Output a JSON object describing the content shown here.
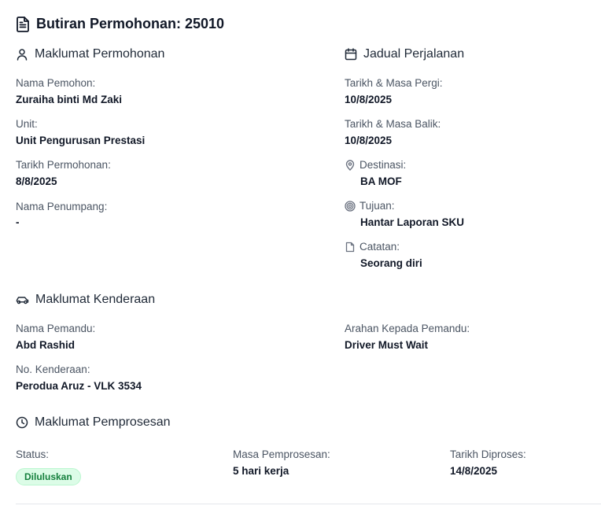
{
  "header": {
    "title": "Butiran Permohonan: 25010",
    "icon": "document-icon"
  },
  "applicant": {
    "heading": "Maklumat Permohonan",
    "icon": "user-icon",
    "fields": [
      {
        "label": "Nama Pemohon:",
        "value": "Zuraiha binti Md Zaki"
      },
      {
        "label": "Unit:",
        "value": "Unit Pengurusan Prestasi"
      },
      {
        "label": "Tarikh Permohonan:",
        "value": "8/8/2025"
      },
      {
        "label": "Nama Penumpang:",
        "value": "-"
      }
    ]
  },
  "schedule": {
    "heading": "Jadual Perjalanan",
    "icon": "calendar-icon",
    "fields": [
      {
        "label": "Tarikh & Masa Pergi:",
        "value": "10/8/2025"
      },
      {
        "label": "Tarikh & Masa Balik:",
        "value": "10/8/2025"
      },
      {
        "label": "Destinasi:",
        "value": "BA MOF",
        "icon": "map-pin-icon"
      },
      {
        "label": "Tujuan:",
        "value": "Hantar Laporan SKU",
        "icon": "target-icon"
      },
      {
        "label": "Catatan:",
        "value": "Seorang diri",
        "icon": "file-icon"
      }
    ]
  },
  "vehicle": {
    "heading": "Maklumat Kenderaan",
    "icon": "car-icon",
    "fields": [
      {
        "label": "Nama Pemandu:",
        "value": "Abd Rashid"
      },
      {
        "label": "Arahan Kepada Pemandu:",
        "value": "Driver Must Wait"
      },
      {
        "label": "No. Kenderaan:",
        "value": "Perodua Aruz - VLK 3534"
      }
    ]
  },
  "processing": {
    "heading": "Maklumat Pemprosesan",
    "icon": "clock-icon",
    "status_label": "Status:",
    "status_value": "Diluluskan",
    "status_color": "#15803d",
    "duration_label": "Masa Pemprosesan:",
    "duration_value": "5 hari kerja",
    "processed_label": "Tarikh Diproses:",
    "processed_value": "14/8/2025"
  }
}
